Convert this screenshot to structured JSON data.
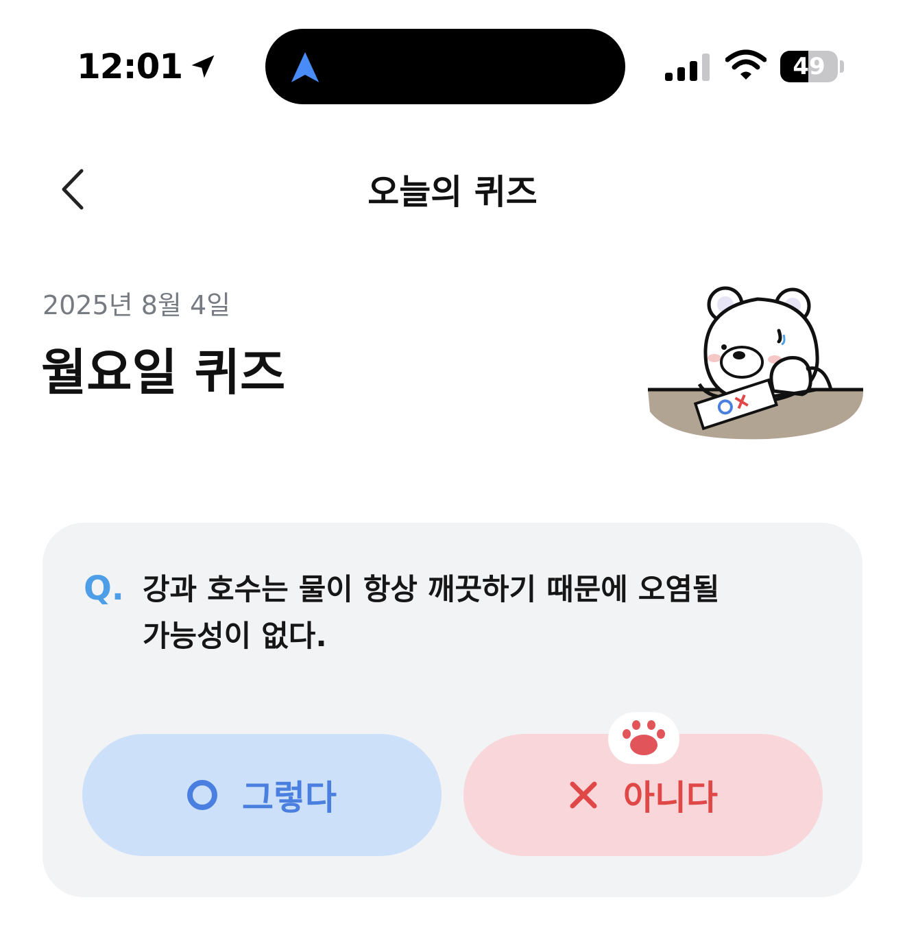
{
  "status_bar": {
    "time": "12:01",
    "battery_percent": "49",
    "battery_level": 0.49,
    "signal_bars": 3,
    "icons": [
      "location-arrow-icon",
      "navigation-arrow-icon",
      "cellular-signal-icon",
      "wifi-icon",
      "battery-icon"
    ]
  },
  "header": {
    "title": "오늘의 퀴즈",
    "back_icon": "chevron-left-icon"
  },
  "quiz": {
    "date": "2025년 8월 4일",
    "title": "월요일 퀴즈",
    "illustration": "bear-with-ox-sheet"
  },
  "question": {
    "marker": "Q.",
    "line1": "강과 호수는 물이 항상 깨끗하기 때문에 오염될",
    "line2": "가능성이 없다."
  },
  "answers": {
    "yes": {
      "label": "그렇다",
      "icon": "circle-o-icon"
    },
    "no": {
      "label": "아니다",
      "icon": "x-icon"
    },
    "selected_marker_icon": "paw-icon"
  },
  "colors": {
    "accent_blue": "#4a7fe0",
    "accent_red": "#e04848",
    "card_bg": "#f2f3f5",
    "yes_bg": "#cde0fa",
    "no_bg": "#f8d6da",
    "q_marker": "#4d9ee6"
  }
}
